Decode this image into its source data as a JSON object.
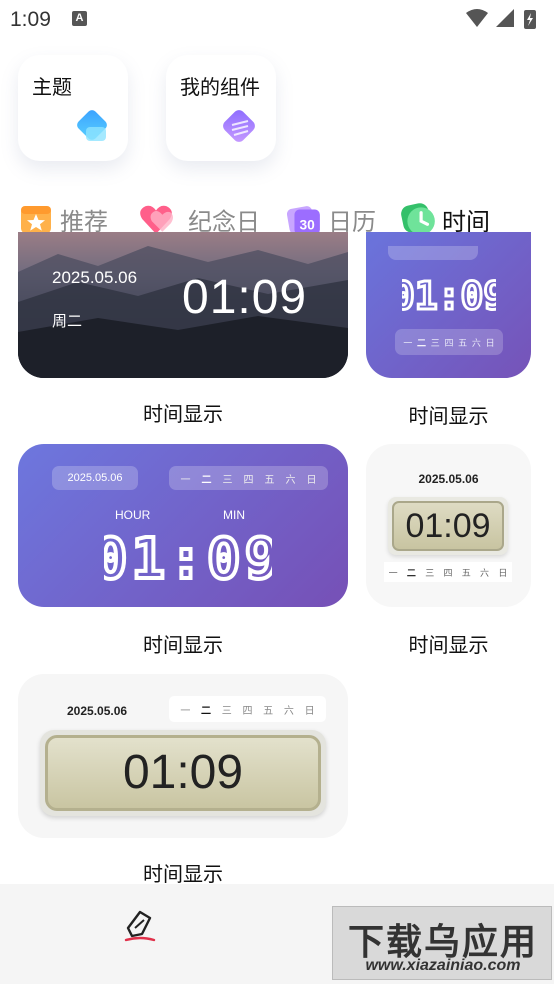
{
  "status_bar": {
    "time": "1:09",
    "notification_icon": "A"
  },
  "entries": [
    {
      "label": "主题",
      "icon": "theme-icon"
    },
    {
      "label": "我的组件",
      "icon": "layers-icon"
    }
  ],
  "tabs": [
    {
      "label": "推荐",
      "icon": "star-icon"
    },
    {
      "label": "纪念日",
      "icon": "heart-icon"
    },
    {
      "label": "日历",
      "icon": "calendar-icon",
      "icon_text": "30"
    },
    {
      "label": "时间",
      "icon": "clock-icon",
      "active": true
    }
  ],
  "widgets": {
    "w1": {
      "date": "2025.05.06",
      "weekday": "周二",
      "time": "01:09",
      "caption": "时间显示"
    },
    "w2": {
      "time": "01:09",
      "days": [
        "一",
        "二",
        "三",
        "四",
        "五",
        "六",
        "日"
      ],
      "caption": "时间显示"
    },
    "w3": {
      "date": "2025.05.06",
      "days": [
        "一",
        "二",
        "三",
        "四",
        "五",
        "六",
        "日"
      ],
      "hour_label": "HOUR",
      "min_label": "MIN",
      "time": "01:09",
      "caption": "时间显示"
    },
    "w4": {
      "date": "2025.05.06",
      "time": "01:09",
      "days": [
        "一",
        "二",
        "三",
        "四",
        "五",
        "六",
        "日"
      ],
      "caption": "时间显示"
    },
    "w5": {
      "date": "2025.05.06",
      "time": "01:09",
      "days": [
        "一",
        "二",
        "三",
        "四",
        "五",
        "六",
        "日"
      ],
      "caption": "时间显示"
    }
  },
  "bottom_nav": {
    "icon": "pen-icon"
  },
  "watermark": {
    "title": "下载乌应用",
    "url": "www.xiazainiao.com"
  },
  "colors": {
    "purple_start": "#6a74dc",
    "purple_end": "#7650b6",
    "lcd": "#c8c4a1"
  }
}
